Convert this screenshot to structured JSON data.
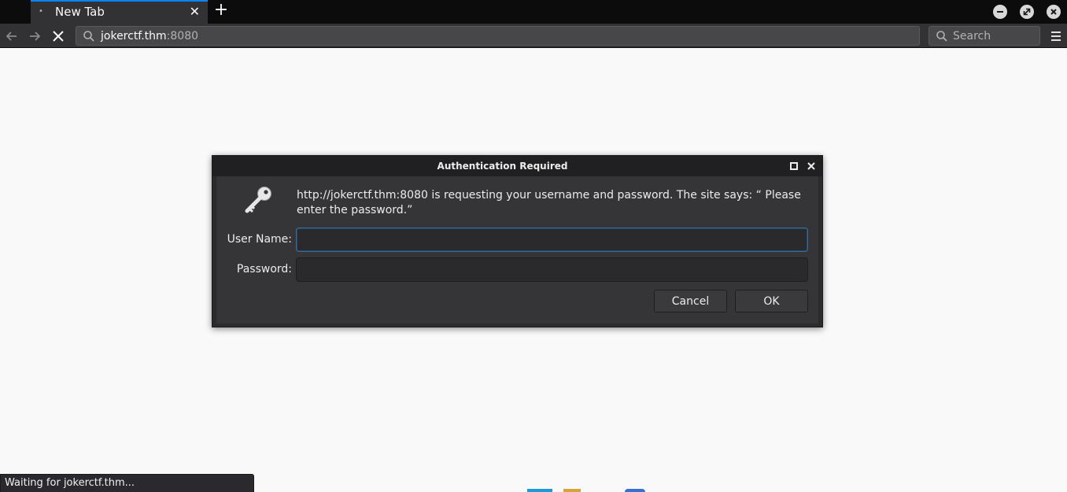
{
  "browser": {
    "tab": {
      "title": "New Tab",
      "close_icon": "close-icon",
      "loading_dot": "•"
    },
    "new_tab_label": "+",
    "window_controls": [
      "minimize-icon",
      "restore-icon",
      "close-icon"
    ],
    "nav": {
      "back_icon": "arrow-left-icon",
      "forward_icon": "arrow-right-icon",
      "stop_icon": "stop-icon"
    },
    "urlbar": {
      "host": "jokerctf.thm",
      "port": ":8080",
      "icon": "search-icon"
    },
    "search": {
      "placeholder": "Search",
      "icon": "search-icon"
    },
    "menu_icon": "hamburger-menu-icon"
  },
  "dialog": {
    "title": "Authentication Required",
    "icon": "key-icon",
    "message": "http://jokerctf.thm:8080 is requesting your username and password. The site says: “ Please enter the password.”",
    "username": {
      "label": "User Name:",
      "value": ""
    },
    "password": {
      "label": "Password:",
      "value": ""
    },
    "cancel_label": "Cancel",
    "ok_label": "OK"
  },
  "status": {
    "text": "Waiting for jokerctf.thm..."
  },
  "colors": {
    "tab_accent": "#0a84ff",
    "chrome_dark": "#0c0c0d",
    "toolbar": "#323234",
    "dialog_body": "#353538",
    "page_bg": "#f9f9fa"
  }
}
